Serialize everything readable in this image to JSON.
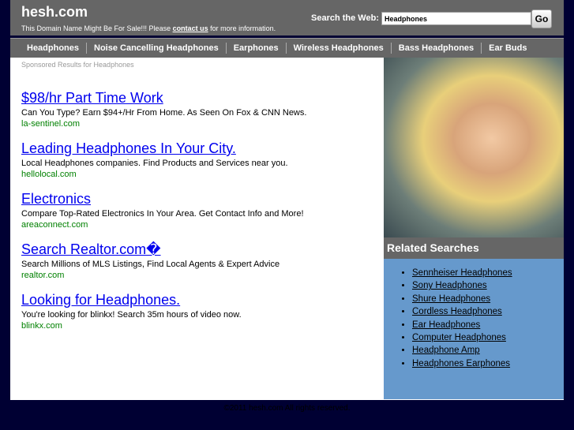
{
  "header": {
    "logo": "hesh.com",
    "sale_prefix": "This Domain Name Might Be For Sale!!! Please ",
    "contact_link": "contact us",
    "sale_suffix": " for more information.",
    "search_label": "Search the Web:",
    "search_value": "Headphones",
    "go_label": "Go"
  },
  "nav": [
    "Headphones",
    "Noise Cancelling Headphones",
    "Earphones",
    "Wireless Headphones",
    "Bass Headphones",
    "Ear Buds"
  ],
  "sponsored": "Sponsored Results for Headphones",
  "results": [
    {
      "title": "$98/hr Part Time Work",
      "desc": "Can You Type? Earn $94+/Hr From Home. As Seen On Fox & CNN News.",
      "url": "la-sentinel.com"
    },
    {
      "title": "Leading Headphones In Your City.",
      "desc": "Local Headphones companies. Find Products and Services near you.",
      "url": "hellolocal.com"
    },
    {
      "title": "Electronics",
      "desc": "Compare Top-Rated Electronics In Your Area. Get Contact Info and More!",
      "url": "areaconnect.com"
    },
    {
      "title": "Search Realtor.com�",
      "desc": "Search Millions of MLS Listings, Find Local Agents & Expert Advice",
      "url": "realtor.com"
    },
    {
      "title": "Looking for Headphones.",
      "desc": "You're looking for blinkx! Search 35m hours of video now.",
      "url": "blinkx.com"
    }
  ],
  "related": {
    "title": "Related Searches",
    "items": [
      "Sennheiser Headphones",
      "Sony Headphones",
      "Shure Headphones",
      "Cordless Headphones",
      "Ear Headphones",
      "Computer Headphones",
      "Headphone Amp",
      "Headphones Earphones"
    ]
  },
  "footer": "©2011 hesh.com All rights reserved."
}
